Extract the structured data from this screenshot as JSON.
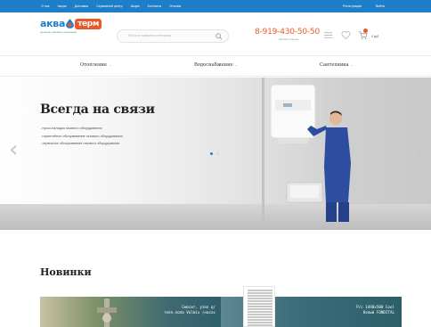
{
  "topbar": {
    "nav": [
      "О нас",
      "Акции",
      "Доставка",
      "Сервисный центр",
      "Акции",
      "Контакты",
      "Отзывы"
    ],
    "right": [
      "Регистрация",
      "Войти"
    ]
  },
  "header": {
    "logo_left": "аква",
    "logo_right": "терм",
    "logo_sub": "интернет-магазин сантехники",
    "search_placeholder": "Поиск по товарам и категориям",
    "phone": "8-919-430-50-50",
    "phone_sub": "Заказать звонок",
    "cart_label": "0 руб."
  },
  "categories": [
    {
      "label": "Отопление"
    },
    {
      "label": "Водоснабжение"
    },
    {
      "label": "Сантехника"
    }
  ],
  "hero": {
    "title": "Всегда на связи",
    "bullets": [
      "- пуско-наладка газового оборудования",
      "- гарантийное обслуживание газового оборудования",
      "- сервисное обслуживание газового оборудования"
    ],
    "prev_arrow": "‹",
    "next_arrow": "›",
    "slides": 2,
    "active_slide": 1
  },
  "novinki": {
    "title": "Новинки",
    "products": [
      {
        "name_line1": "Смесит. узел д/",
        "name_line2": "тепл.пола Valmix (насос"
      },
      {
        "name_line1": "Р/с 1490х500 Cool",
        "name_line2": "белый FONDITAL"
      }
    ]
  },
  "colors": {
    "brand_blue": "#1f7ec8",
    "brand_orange": "#e9592a",
    "brand_green": "#4ba24f"
  }
}
